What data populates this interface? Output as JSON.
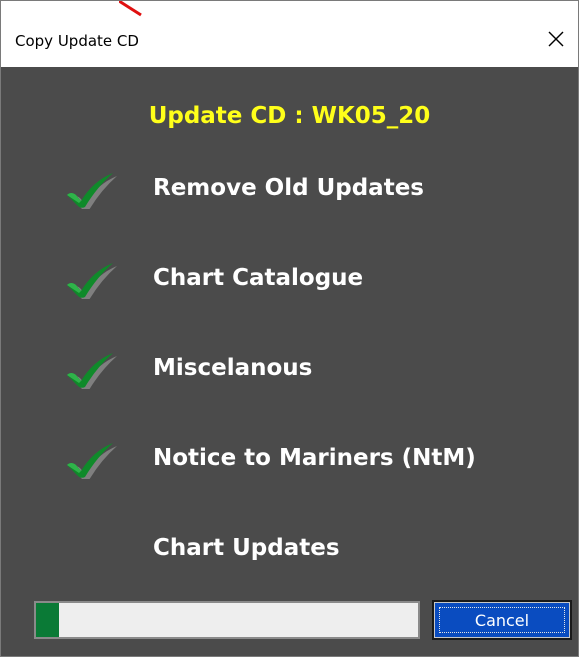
{
  "window": {
    "title": "Copy Update CD"
  },
  "dialog": {
    "heading": "Update CD : WK05_20",
    "heading_color": "#ffff1a",
    "background_color": "#4b4b4b",
    "steps": [
      {
        "label": "Remove Old Updates",
        "done": true,
        "icon": "check-icon"
      },
      {
        "label": "Chart Catalogue",
        "done": true,
        "icon": "check-icon"
      },
      {
        "label": "Miscelanous",
        "done": true,
        "icon": "check-icon"
      },
      {
        "label": "Notice to Mariners (NtM)",
        "done": true,
        "icon": "check-icon"
      },
      {
        "label": "Chart Updates",
        "done": false,
        "icon": ""
      }
    ],
    "progress": {
      "fraction": 0.06,
      "fill_color": "#0a7a36"
    },
    "cancel_label": "Cancel",
    "cancel_color": "#0a4cc0"
  }
}
